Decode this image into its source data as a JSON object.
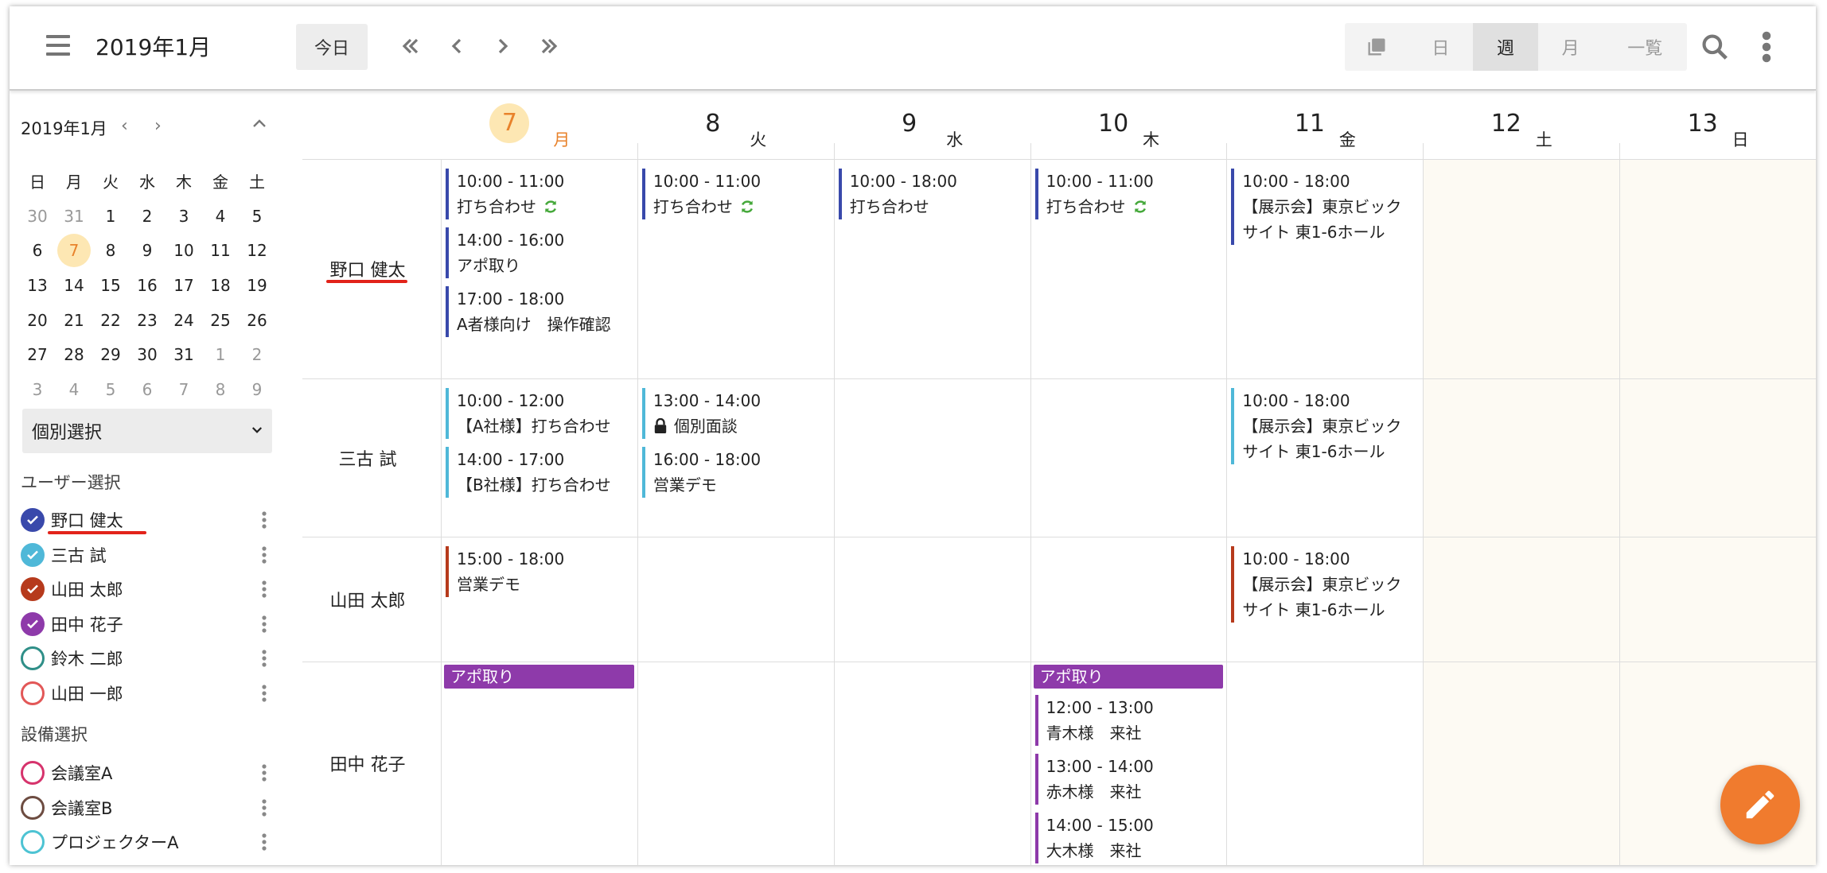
{
  "header": {
    "title": "2019年1月",
    "today_label": "今日",
    "views": [
      "日",
      "週",
      "月",
      "一覧"
    ],
    "active_view": "週"
  },
  "mini_calendar": {
    "title": "2019年1月",
    "prev": "‹",
    "next": "›",
    "weekdays": [
      "日",
      "月",
      "火",
      "水",
      "木",
      "金",
      "土"
    ],
    "weeks": [
      [
        "30",
        "31",
        "1",
        "2",
        "3",
        "4",
        "5"
      ],
      [
        "6",
        "7",
        "8",
        "9",
        "10",
        "11",
        "12"
      ],
      [
        "13",
        "14",
        "15",
        "16",
        "17",
        "18",
        "19"
      ],
      [
        "20",
        "21",
        "22",
        "23",
        "24",
        "25",
        "26"
      ],
      [
        "27",
        "28",
        "29",
        "30",
        "31",
        "1",
        "2"
      ],
      [
        "3",
        "4",
        "5",
        "6",
        "7",
        "8",
        "9"
      ]
    ],
    "today": "7"
  },
  "filter": {
    "selected": "個別選択"
  },
  "user_section": {
    "title": "ユーザー選択",
    "users": [
      {
        "name": "野口 健太",
        "checked": true,
        "color": "#3949ab"
      },
      {
        "name": "三古 試",
        "checked": true,
        "color": "#4fb8d8"
      },
      {
        "name": "山田 太郎",
        "checked": true,
        "color": "#b63a1c"
      },
      {
        "name": "田中 花子",
        "checked": true,
        "color": "#8e3aaa"
      },
      {
        "name": "鈴木 二郎",
        "checked": false,
        "color": "#2f8f88"
      },
      {
        "name": "山田 一郎",
        "checked": false,
        "color": "#e25757"
      }
    ]
  },
  "equipment_section": {
    "title": "設備選択",
    "items": [
      {
        "name": "会議室A",
        "checked": false,
        "color": "#d6336c"
      },
      {
        "name": "会議室B",
        "checked": false,
        "color": "#6d4c41"
      },
      {
        "name": "プロジェクターA",
        "checked": false,
        "color": "#4dc3d3"
      }
    ]
  },
  "days": [
    {
      "num": "7",
      "wd": "月",
      "today": true
    },
    {
      "num": "8",
      "wd": "火"
    },
    {
      "num": "9",
      "wd": "水"
    },
    {
      "num": "10",
      "wd": "木"
    },
    {
      "num": "11",
      "wd": "金"
    },
    {
      "num": "12",
      "wd": "土"
    },
    {
      "num": "13",
      "wd": "日"
    }
  ],
  "rows": [
    {
      "name": "野口 健太",
      "color": "#3949ab",
      "events": [
        {
          "day": 0,
          "time": "10:00 - 11:00",
          "title": "打ち合わせ",
          "sync": true
        },
        {
          "day": 0,
          "time": "14:00 - 16:00",
          "title": "アポ取り"
        },
        {
          "day": 0,
          "time": "17:00 - 18:00",
          "title": "A者様向け　操作確認"
        },
        {
          "day": 1,
          "time": "10:00 - 11:00",
          "title": "打ち合わせ",
          "sync": true
        },
        {
          "day": 2,
          "time": "10:00 - 18:00",
          "title": "打ち合わせ"
        },
        {
          "day": 3,
          "time": "10:00 - 11:00",
          "title": "打ち合わせ",
          "sync": true
        },
        {
          "day": 4,
          "time": "10:00 - 18:00",
          "title": "【展示会】東京ビック",
          "title2": "サイト 東1-6ホール"
        }
      ]
    },
    {
      "name": "三古 試",
      "color": "#4fb8d8",
      "events": [
        {
          "day": 0,
          "time": "10:00 - 12:00",
          "title": "【A社様】打ち合わせ"
        },
        {
          "day": 0,
          "time": "14:00 - 17:00",
          "title": "【B社様】打ち合わせ"
        },
        {
          "day": 1,
          "time": "13:00 - 14:00",
          "title": "個別面談",
          "lock": true
        },
        {
          "day": 1,
          "time": "16:00 - 18:00",
          "title": "営業デモ"
        },
        {
          "day": 4,
          "time": "10:00 - 18:00",
          "title": "【展示会】東京ビック",
          "title2": "サイト 東1-6ホール"
        }
      ]
    },
    {
      "name": "山田 太郎",
      "color": "#b63a1c",
      "events": [
        {
          "day": 0,
          "time": "15:00 - 18:00",
          "title": "営業デモ"
        },
        {
          "day": 4,
          "time": "10:00 - 18:00",
          "title": "【展示会】東京ビック",
          "title2": "サイト 東1-6ホール"
        }
      ]
    },
    {
      "name": "田中 花子",
      "color": "#8e3aaa",
      "allday": [
        {
          "day": 0,
          "title": "アポ取り"
        },
        {
          "day": 3,
          "title": "アポ取り"
        }
      ],
      "events": [
        {
          "day": 3,
          "time": "12:00 - 13:00",
          "title": "青木様　来社"
        },
        {
          "day": 3,
          "time": "13:00 - 14:00",
          "title": "赤木様　来社"
        },
        {
          "day": 3,
          "time": "14:00 - 15:00",
          "title": "大木様　来社"
        }
      ]
    }
  ]
}
